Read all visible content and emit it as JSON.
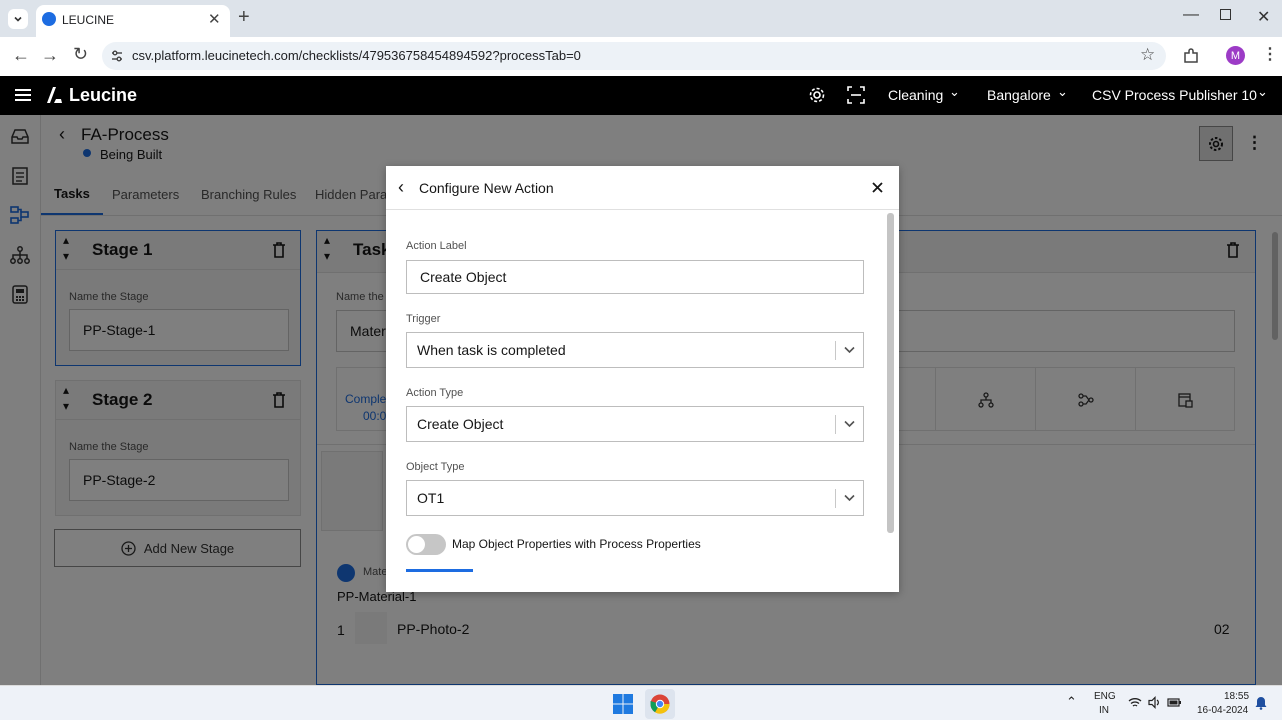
{
  "browser": {
    "tab_title": "LEUCINE",
    "url": "csv.platform.leucinetech.com/checklists/479536758454894592?processTab=0",
    "profile_initial": "M"
  },
  "header": {
    "brand": "Leucine",
    "use_case": "Cleaning",
    "facility": "Bangalore",
    "user": "CSV Process Publisher 10"
  },
  "process": {
    "title": "FA-Process",
    "status": "Being Built",
    "status_color": "#1d6ce1"
  },
  "tabs": [
    "Tasks",
    "Parameters",
    "Branching Rules",
    "Hidden Param"
  ],
  "stages": [
    {
      "title": "Stage 1",
      "name_label": "Name the Stage",
      "name_value": "PP-Stage-1"
    },
    {
      "title": "Stage 2",
      "name_label": "Name the Stage",
      "name_value": "PP-Stage-2"
    }
  ],
  "add_stage_label": "Add New Stage",
  "task_panel": {
    "title": "Task",
    "name_label": "Name the t",
    "name_value": "Materi",
    "completion_label": "Complet",
    "completion_value": "00:0",
    "param_label": "Mate",
    "material_text": "PP-Material-1",
    "row_index": "1",
    "row_label": "PP-Photo-2",
    "row_count": "02"
  },
  "modal": {
    "title": "Configure New Action",
    "action_label_label": "Action Label",
    "action_label_value": "Create Object",
    "trigger_label": "Trigger",
    "trigger_value": "When task is completed",
    "action_type_label": "Action Type",
    "action_type_value": "Create Object",
    "object_type_label": "Object Type",
    "object_type_value": "OT1",
    "toggle_label": "Map Object Properties with Process Properties",
    "toggle_on": false
  },
  "taskbar": {
    "lang_1": "ENG",
    "lang_2": "IN",
    "time": "18:55",
    "date": "16-04-2024"
  },
  "colors": {
    "accent": "#1d6ce1",
    "header_bg": "#000000",
    "overlay": "rgba(0,0,0,0.5)"
  }
}
